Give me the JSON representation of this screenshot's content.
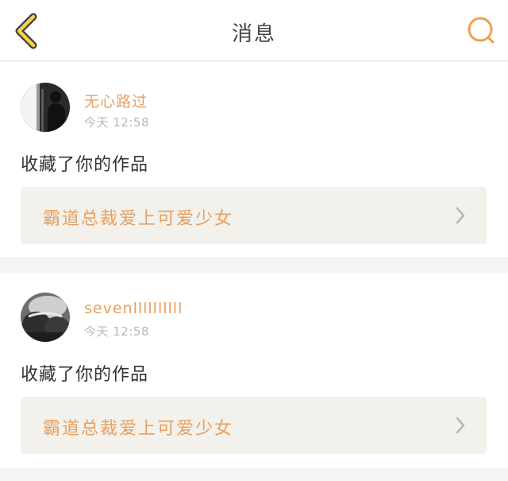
{
  "header": {
    "title": "消息",
    "back_icon": "chevron-left-icon",
    "search_icon": "search-icon",
    "accent_color": "#f0a050"
  },
  "notifications": [
    {
      "username": "无心路过",
      "time": "今天 12:58",
      "action": "收藏了你的作品",
      "work_title": "霸道总裁爱上可爱少女",
      "avatar_icon": "silhouette-avatar"
    },
    {
      "username": "sevenllllllllll",
      "time": "今天 12:58",
      "action": "收藏了你的作品",
      "work_title": "霸道总裁爱上可爱少女",
      "avatar_icon": "grayscale-photo-avatar"
    }
  ],
  "colors": {
    "username": "#e8a060",
    "work_title": "#e8a060",
    "time": "#b8b8b8",
    "link_bg": "#f2f1ec"
  }
}
